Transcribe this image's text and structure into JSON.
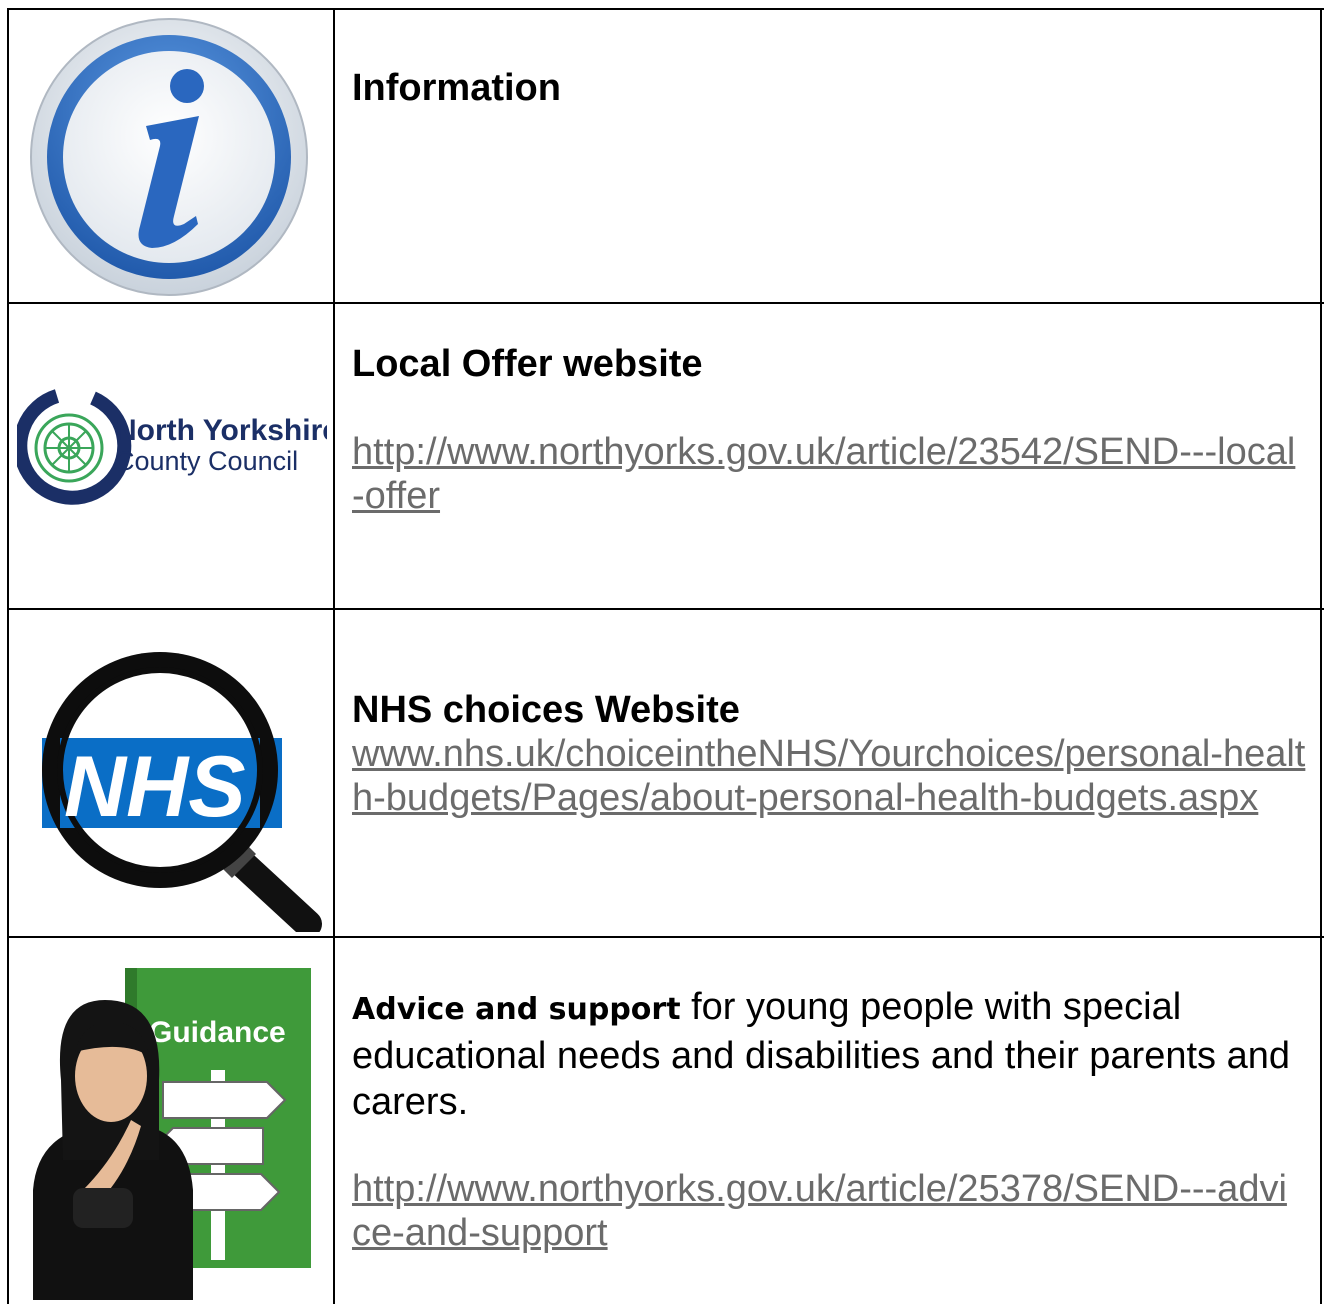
{
  "rows": [
    {
      "icon": "information-icon",
      "heading": "Information"
    },
    {
      "icon": "north-yorkshire-county-council-logo",
      "logo_text_line1": "North Yorkshire",
      "logo_text_line2": "County Council",
      "heading": "Local Offer website",
      "link": "http://www.northyorks.gov.uk/article/23542/SEND---local-offer"
    },
    {
      "icon": "nhs-magnifier-icon",
      "logo_text": "NHS",
      "heading": "NHS choices Website",
      "link": "www.nhs.uk/choiceintheNHS/Yourchoices/personal-health-budgets/Pages/about-personal-health-budgets.aspx"
    },
    {
      "icon": "guidance-person-icon",
      "sign_text": "Guidance",
      "bold_lead": "Advice and support",
      "text": " for young people with special educational needs and disabilities and their parents and carers.",
      "link": "http://www.northyorks.gov.uk/article/25378/SEND---advice-and-support"
    }
  ],
  "colors": {
    "link": "#6b6b6b",
    "info_blue": "#2f6fc4",
    "nycc_navy": "#1b2f66",
    "nycc_green": "#3aa65a",
    "nhs_blue": "#0a6ec6",
    "guidance_green": "#3f9a3a"
  }
}
